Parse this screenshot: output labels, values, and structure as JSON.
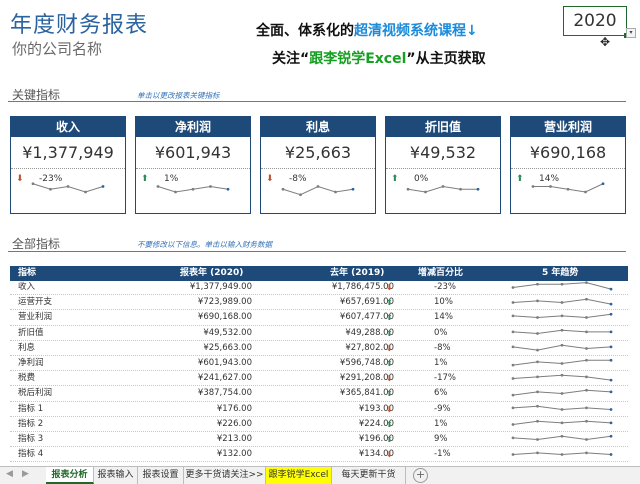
{
  "header": {
    "title": "年度财务报表",
    "subtitle": "你的公司名称",
    "promo_line1_a": "全面、体系化的",
    "promo_line1_b": "超清视频系统课程↓",
    "promo_line2_a": "关注“",
    "promo_line2_b": "跟李锐学Excel",
    "promo_line2_c": "”从主页获取",
    "year": "2020",
    "dropdown_glyph": "▾",
    "cursor_glyph": "✥"
  },
  "kpi_section": {
    "label": "关键指标",
    "hint": "单击以更改报表关键指标"
  },
  "kpis": [
    {
      "name": "收入",
      "value": "¥1,377,949",
      "dir": "down",
      "arrow": "⬇",
      "pct": "-23%",
      "spark": [
        7,
        5,
        6,
        4,
        6
      ]
    },
    {
      "name": "净利润",
      "value": "¥601,943",
      "dir": "up",
      "arrow": "⬆",
      "pct": "1%",
      "spark": [
        6,
        4,
        5,
        6,
        5
      ]
    },
    {
      "name": "利息",
      "value": "¥25,663",
      "dir": "down",
      "arrow": "⬇",
      "pct": "-8%",
      "spark": [
        5,
        3,
        6,
        4,
        5
      ]
    },
    {
      "name": "折旧值",
      "value": "¥49,532",
      "dir": "up",
      "arrow": "⬆",
      "pct": "0%",
      "spark": [
        5,
        4,
        6,
        5,
        5
      ]
    },
    {
      "name": "营业利润",
      "value": "¥690,168",
      "dir": "up",
      "arrow": "⬆",
      "pct": "14%",
      "spark": [
        6,
        6,
        5,
        4,
        7
      ]
    }
  ],
  "all_section": {
    "label": "全部指标",
    "hint": "不要修改以下信息。单击以输入财务数据"
  },
  "table": {
    "headers": {
      "name": "指标",
      "cur": "报表年 (2020)",
      "prev": "去年 (2019)",
      "change": "增减百分比",
      "trend": "5 年趋势"
    },
    "rows": [
      {
        "name": "收入",
        "cur": "¥1,377,949.00",
        "prev": "¥1,786,475.00",
        "dir": "down",
        "arrow": "⬇",
        "pct": "-23%",
        "spark": [
          4,
          6,
          6,
          7,
          3
        ]
      },
      {
        "name": "运营开支",
        "cur": "¥723,989.00",
        "prev": "¥657,691.00",
        "dir": "up",
        "arrow": "⬆",
        "pct": "10%",
        "spark": [
          4,
          5,
          4,
          6,
          3
        ]
      },
      {
        "name": "营业利润",
        "cur": "¥690,168.00",
        "prev": "¥607,477.00",
        "dir": "up",
        "arrow": "⬆",
        "pct": "14%",
        "spark": [
          5,
          4,
          5,
          4,
          6
        ]
      },
      {
        "name": "折旧值",
        "cur": "¥49,532.00",
        "prev": "¥49,288.00",
        "dir": "up",
        "arrow": "⬆",
        "pct": "0%",
        "spark": [
          5,
          4,
          6,
          5,
          5
        ]
      },
      {
        "name": "利息",
        "cur": "¥25,663.00",
        "prev": "¥27,802.00",
        "dir": "down",
        "arrow": "⬇",
        "pct": "-8%",
        "spark": [
          5,
          3,
          6,
          4,
          5
        ]
      },
      {
        "name": "净利润",
        "cur": "¥601,943.00",
        "prev": "¥596,748.00",
        "dir": "up",
        "arrow": "⬆",
        "pct": "1%",
        "spark": [
          3,
          5,
          4,
          6,
          6
        ]
      },
      {
        "name": "税费",
        "cur": "¥241,627.00",
        "prev": "¥291,208.00",
        "dir": "down",
        "arrow": "⬇",
        "pct": "-17%",
        "spark": [
          4,
          5,
          6,
          5,
          3
        ]
      },
      {
        "name": "税后利润",
        "cur": "¥387,754.00",
        "prev": "¥365,841.00",
        "dir": "up",
        "arrow": "⬆",
        "pct": "6%",
        "spark": [
          3,
          5,
          4,
          6,
          5
        ]
      },
      {
        "name": "指标 1",
        "cur": "¥176.00",
        "prev": "¥193.00",
        "dir": "down",
        "arrow": "⬇",
        "pct": "-9%",
        "spark": [
          5,
          6,
          4,
          5,
          4
        ]
      },
      {
        "name": "指标 2",
        "cur": "¥226.00",
        "prev": "¥224.00",
        "dir": "up",
        "arrow": "⬆",
        "pct": "1%",
        "spark": [
          4,
          6,
          5,
          6,
          5
        ]
      },
      {
        "name": "指标 3",
        "cur": "¥213.00",
        "prev": "¥196.00",
        "dir": "up",
        "arrow": "⬆",
        "pct": "9%",
        "spark": [
          5,
          4,
          6,
          4,
          6
        ]
      },
      {
        "name": "指标 4",
        "cur": "¥132.00",
        "prev": "¥134.00",
        "dir": "down",
        "arrow": "⬇",
        "pct": "-1%",
        "spark": [
          4,
          5,
          4,
          5,
          4
        ]
      }
    ]
  },
  "tabs": [
    {
      "label": "报表分析",
      "active": true
    },
    {
      "label": "报表输入"
    },
    {
      "label": "报表设置"
    },
    {
      "label": "更多干货请关注>>"
    },
    {
      "label": "跟李锐学Excel",
      "highlight": true
    },
    {
      "label": "每天更新干货"
    }
  ],
  "nav": {
    "prev": "◀",
    "next": "▶",
    "add": "+"
  }
}
